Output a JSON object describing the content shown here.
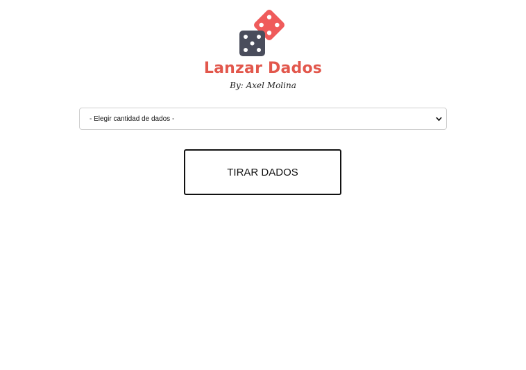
{
  "header": {
    "title": "Lanzar Dados",
    "byline": "By: Axel Molina",
    "logo_icon": "dice-icon"
  },
  "controls": {
    "select_value": "- Elegir cantidad de dados -",
    "roll_button_label": "TIRAR DADOS"
  },
  "colors": {
    "accent": "#e2574c",
    "dark_die": "#4a4d5c",
    "red_die": "#ef5b5b"
  }
}
